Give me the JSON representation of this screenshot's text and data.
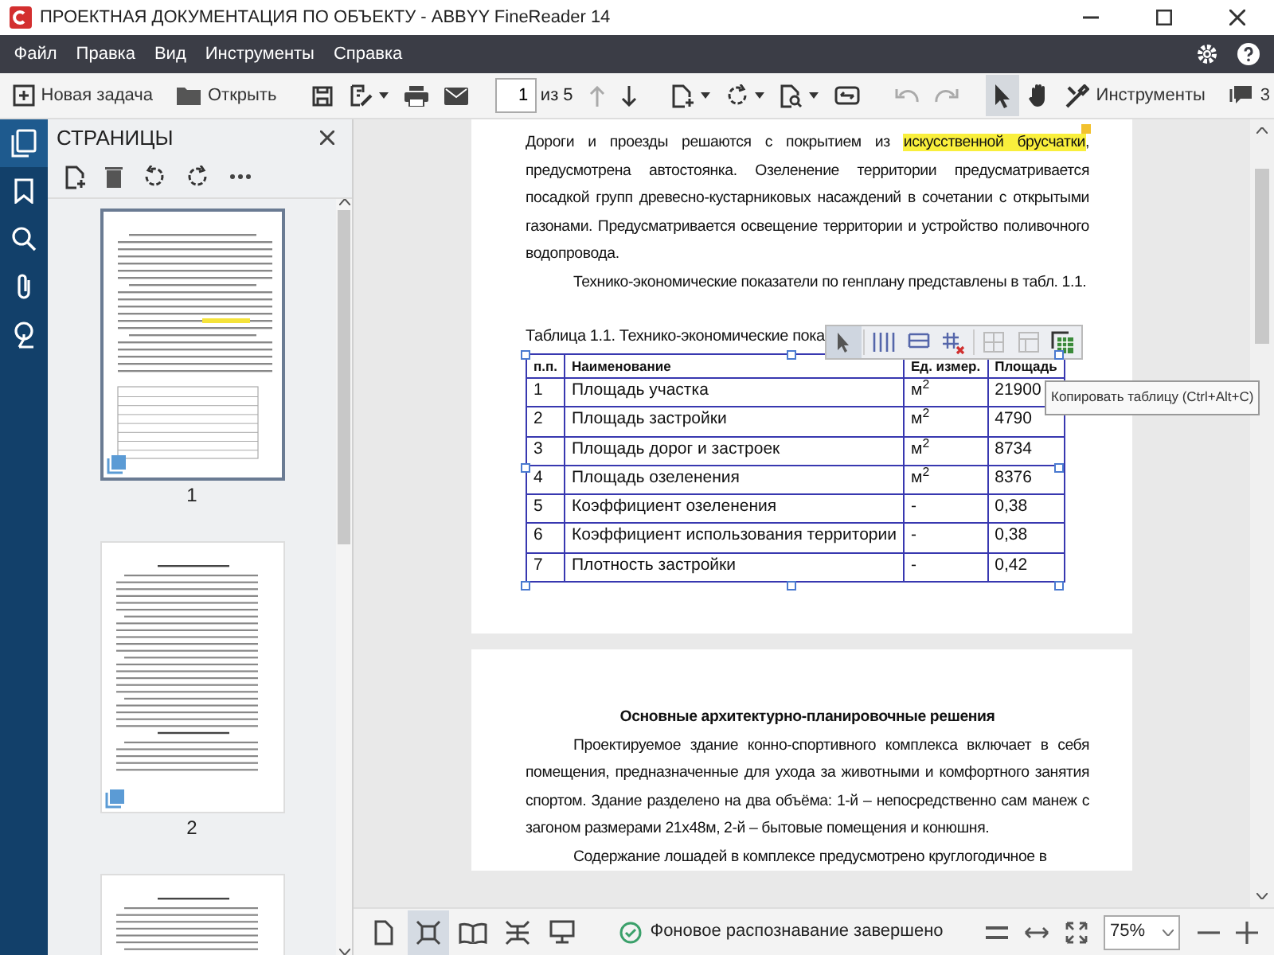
{
  "window": {
    "title": "ПРОЕКТНАЯ ДОКУМЕНТАЦИЯ ПО ОБЪЕКТУ - ABBYY FineReader 14"
  },
  "menu": [
    "Файл",
    "Правка",
    "Вид",
    "Инструменты",
    "Справка"
  ],
  "toolbar": {
    "new_task": "Новая задача",
    "open": "Открыть",
    "page_number": "1",
    "page_total": "из 5",
    "tools": "Инструменты",
    "comments_count": "3",
    "pointer_tools": [
      {
        "selected": true
      },
      {
        "selected": false
      }
    ]
  },
  "rail_items": [
    {
      "selected": true
    },
    {
      "selected": false
    },
    {
      "selected": false
    },
    {
      "selected": false
    },
    {
      "selected": false
    }
  ],
  "pages_panel": {
    "title": "СТРАНИЦЫ",
    "thumbnails": [
      {
        "label": "1",
        "selected": true
      },
      {
        "label": "2",
        "selected": false
      },
      {
        "selected": false
      }
    ]
  },
  "document": {
    "page_1": {
      "paragraphs": [
        {
          "indent": false,
          "segments": [
            {
              "text": "Дороги и проезды решаются с покрытием из ",
              "highlighted": false
            },
            {
              "text": "искусственной брусчатки",
              "highlighted": true
            },
            {
              "text": ", предусмотрена автостоянка. Озеленение территории предусматривается посадкой групп древесно-кустарниковых насаждений в сочетании с открытыми газонами. Предусматривается освещение территории и устройство поливочного водопровода.",
              "highlighted": false
            }
          ]
        },
        {
          "indent": true,
          "segments": [
            {
              "text": "Технико-экономические показатели по генплану представлены в табл. 1.1.",
              "highlighted": false
            }
          ]
        }
      ],
      "table_caption": "Таблица 1.1. Технико-экономические пока",
      "table": {
        "columns": [
          "п.п.",
          "Наименование",
          "Ед. измер.",
          "Площадь"
        ],
        "rows": [
          [
            "1",
            "Площадь участка",
            "м$^{2}$",
            "21900"
          ],
          [
            "2",
            "Площадь застройки",
            "м$^{2}$",
            "4790"
          ],
          [
            "3",
            "Площадь дорог и застроек",
            "м$^{2}$",
            "8734"
          ],
          [
            "4",
            "Площадь озеленения",
            "м$^{2}$",
            "8376"
          ],
          [
            "5",
            "Коэффициент озеленения",
            "-",
            "0,38"
          ],
          [
            "6",
            "Коэффициент использования территории",
            "-",
            "0,38"
          ],
          [
            "7",
            "Плотность застройки",
            "-",
            "0,42"
          ]
        ]
      },
      "table_toolbar": [
        {
          "selected": true
        },
        {
          "selected": false
        },
        {
          "selected": false
        },
        {
          "selected": false
        },
        {
          "selected": false
        },
        {
          "selected": false
        },
        {
          "selected": false
        }
      ],
      "tooltip": "Копировать таблицу (Ctrl+Alt+C)"
    },
    "page_2": {
      "heading": "Основные архитектурно-планировочные решения",
      "paragraphs": [
        "Проектируемое здание конно-спортивного комплекса включает в себя помещения, предназначенные для ухода за животными и комфортного занятия спортом. Здание разделено на два объёма: 1-й – непосредственно сам манеж с загоном размерами 21х48м, 2-й – бытовые помещения и конюшня.",
        "Содержание лошадей в комплексе предусмотрено круглогодичное в"
      ]
    }
  },
  "status_bar": {
    "view_modes": [
      {
        "selected": false
      },
      {
        "selected": true
      },
      {
        "selected": false
      },
      {
        "selected": false
      },
      {
        "selected": false
      }
    ],
    "message": "Фоновое распознавание завершено",
    "zoom": "75%"
  }
}
